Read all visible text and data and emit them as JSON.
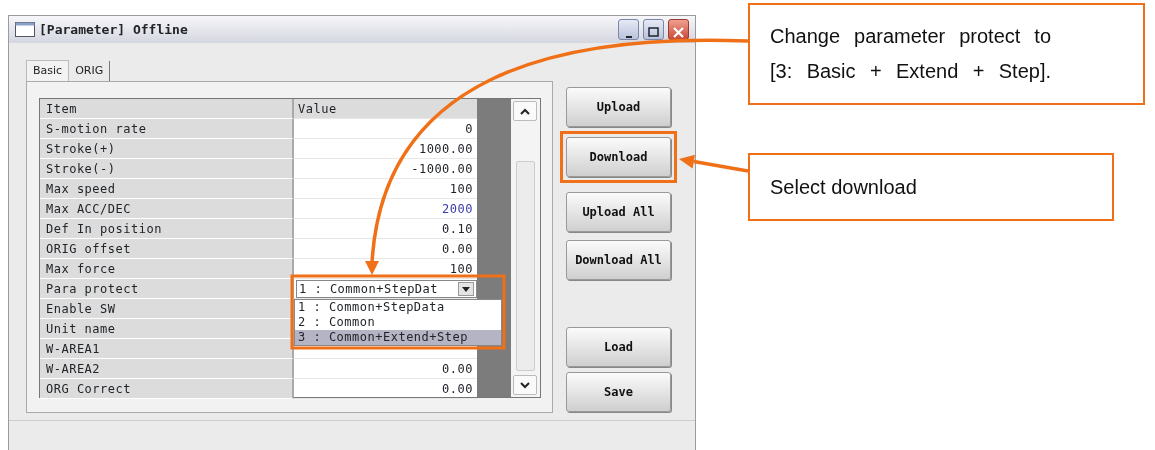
{
  "window": {
    "title": "[Parameter] Offline"
  },
  "tabs": [
    {
      "label": "Basic",
      "selected": true
    },
    {
      "label": "ORIG",
      "selected": false
    }
  ],
  "table": {
    "columns": [
      "Item",
      "Value"
    ],
    "rows": [
      {
        "kind": "text",
        "item": "S-motion rate",
        "value": "0",
        "modified": false
      },
      {
        "kind": "text",
        "item": "Stroke(+)",
        "value": "1000.00",
        "modified": false
      },
      {
        "kind": "text",
        "item": "Stroke(-)",
        "value": "-1000.00",
        "modified": false
      },
      {
        "kind": "text",
        "item": "Max speed",
        "value": "100",
        "modified": false
      },
      {
        "kind": "text",
        "item": "Max ACC/DEC",
        "value": "2000",
        "modified": true
      },
      {
        "kind": "text",
        "item": "Def In position",
        "value": "0.10",
        "modified": false
      },
      {
        "kind": "text",
        "item": "ORIG offset",
        "value": "0.00",
        "modified": false
      },
      {
        "kind": "text",
        "item": "Max force",
        "value": "100",
        "modified": false
      },
      {
        "kind": "dropdown",
        "item": "Para protect",
        "value": "1 : Common+StepDat",
        "open": true,
        "highlighted": true,
        "options": [
          {
            "label": "1 : Common+StepData",
            "selected": false
          },
          {
            "label": "2 : Common",
            "selected": false
          },
          {
            "label": "3 : Common+Extend+Step",
            "selected": true
          }
        ]
      },
      {
        "kind": "text",
        "item": "Enable SW"
      },
      {
        "kind": "text",
        "item": "Unit name"
      },
      {
        "kind": "text",
        "item": "W-AREA1"
      },
      {
        "kind": "text",
        "item": "W-AREA2",
        "value": "0.00",
        "modified": false
      },
      {
        "kind": "text",
        "item": "ORG Correct",
        "value": "0.00",
        "modified": false
      }
    ]
  },
  "buttons": [
    {
      "label": "Upload",
      "highlighted": false
    },
    {
      "label": "Download",
      "highlighted": true
    },
    {
      "label": "Upload All",
      "highlighted": false
    },
    {
      "label": "Download All",
      "highlighted": false
    },
    {
      "label": "Load",
      "highlighted": false
    },
    {
      "label": "Save",
      "highlighted": false
    }
  ],
  "callouts": [
    {
      "text": "Change parameter protect to [3: Basic + Extend + Step]."
    },
    {
      "text": "Select download"
    }
  ]
}
